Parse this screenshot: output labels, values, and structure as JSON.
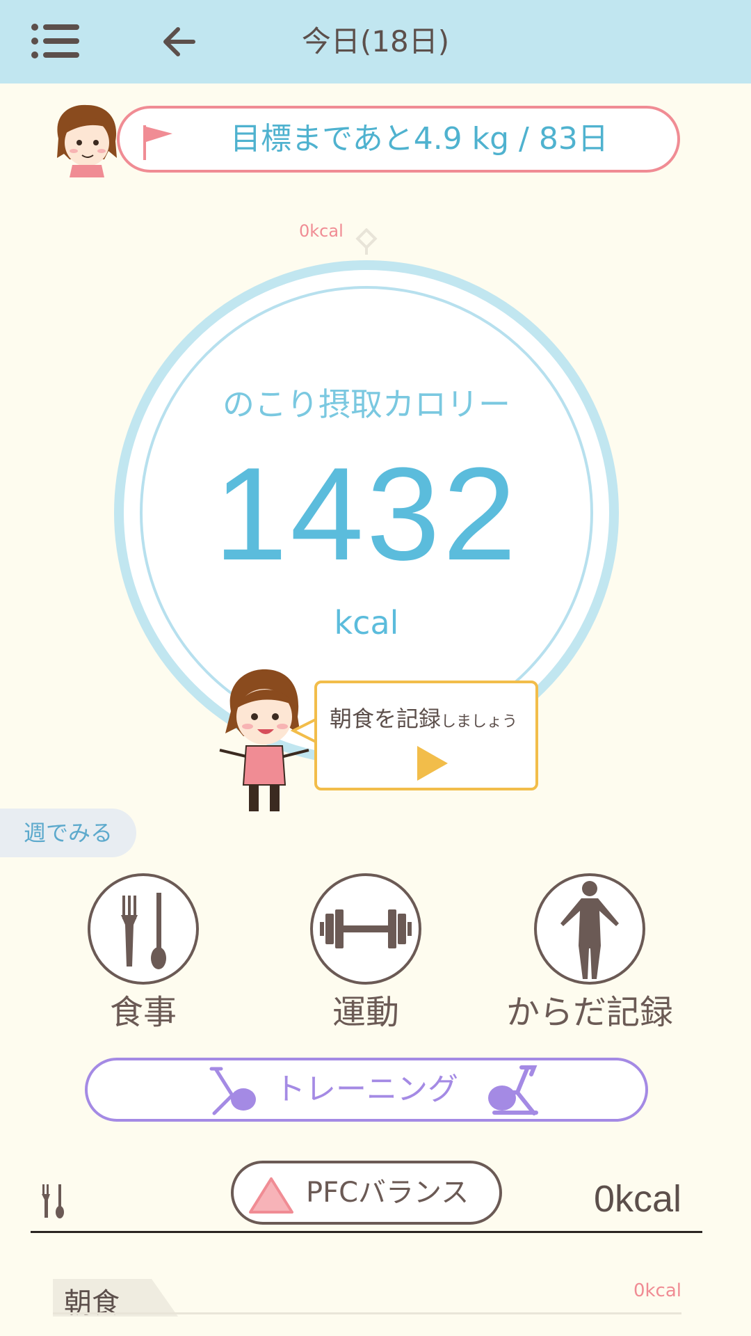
{
  "header": {
    "title": "今日(18日)",
    "menu_icon": "hamburger-menu-icon",
    "back_icon": "arrow-left-icon"
  },
  "goal": {
    "text": "目標まであと4.9 kg / 83日",
    "flag_icon": "flag-icon",
    "avatar": "avatar-face"
  },
  "calorie_ring": {
    "top_label": "0kcal",
    "caption": "のこり摂取カロリー",
    "value": "1432",
    "unit": "kcal",
    "remaining_fraction": 1.0
  },
  "prompt_bubble": {
    "main": "朝食を記録",
    "suffix": "しましょう",
    "play_icon": "play-icon"
  },
  "week_tab": {
    "label": "週でみる"
  },
  "categories": [
    {
      "label": "食事",
      "icon": "fork-spoon-icon"
    },
    {
      "label": "運動",
      "icon": "dumbbell-icon"
    },
    {
      "label": "からだ記録",
      "icon": "body-figure-icon"
    }
  ],
  "training": {
    "label": "トレーニング",
    "icon": "exercise-bike-icon"
  },
  "pfc": {
    "label": "PFCバランス",
    "icon": "triangle-icon",
    "row_icon": "fork-knife-icon",
    "total_kcal": "0kcal"
  },
  "breakfast": {
    "label": "朝食",
    "kcal": "0kcal"
  },
  "colors": {
    "header_bg": "#c1e6f0",
    "page_bg": "#fefcef",
    "accent_blue": "#5bbcdc",
    "pink": "#f08c94",
    "purple": "#a48ae4",
    "yellow": "#f2bd4a",
    "brown": "#6b5a55"
  }
}
